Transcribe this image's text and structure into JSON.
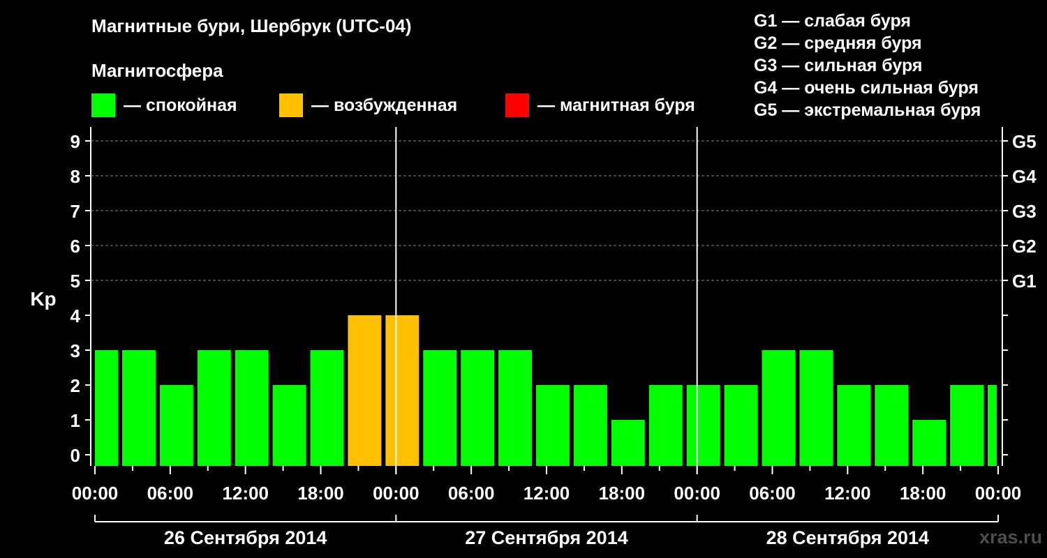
{
  "title": "Магнитные бури, Шербрук (UTC-04)",
  "magnetosphere_heading": "Магнитосфера",
  "legend": [
    {
      "color": "#00ff00",
      "label": "— спокойная"
    },
    {
      "color": "#ffc000",
      "label": "— возбужденная"
    },
    {
      "color": "#ff0000",
      "label": "— магнитная буря"
    }
  ],
  "g_levels": [
    "G1 — слабая буря",
    "G2 — средняя буря",
    "G3 — сильная буря",
    "G4 — очень сильная буря",
    "G5 — экстремальная буря"
  ],
  "watermark": "xras.ru",
  "colors": {
    "quiet": "#00ff00",
    "active": "#ffc000",
    "storm": "#ff0000",
    "background": "#000000",
    "foreground": "#ffffff"
  },
  "chart_data": {
    "type": "bar",
    "ylabel": "Kp",
    "ylim": [
      0,
      9
    ],
    "yticks": [
      0,
      1,
      2,
      3,
      4,
      5,
      6,
      7,
      8,
      9
    ],
    "right_axis_labels": [
      {
        "kp": 5,
        "label": "G1"
      },
      {
        "kp": 6,
        "label": "G2"
      },
      {
        "kp": 7,
        "label": "G3"
      },
      {
        "kp": 8,
        "label": "G4"
      },
      {
        "kp": 9,
        "label": "G5"
      }
    ],
    "x_range_hours": [
      0,
      72
    ],
    "bar_interval_hours": 3,
    "bar_start_hour": -1,
    "values": [
      3,
      3,
      2,
      3,
      3,
      2,
      3,
      4,
      4,
      3,
      3,
      3,
      2,
      2,
      1,
      2,
      2,
      2,
      3,
      3,
      2,
      2,
      1,
      2,
      2
    ],
    "bar_categories": [
      "quiet",
      "quiet",
      "quiet",
      "quiet",
      "quiet",
      "quiet",
      "quiet",
      "active",
      "active",
      "quiet",
      "quiet",
      "quiet",
      "quiet",
      "quiet",
      "quiet",
      "quiet",
      "quiet",
      "quiet",
      "quiet",
      "quiet",
      "quiet",
      "quiet",
      "quiet",
      "quiet",
      "quiet"
    ],
    "x_tick_labels": [
      "00:00",
      "06:00",
      "12:00",
      "18:00",
      "00:00",
      "06:00",
      "12:00",
      "18:00",
      "00:00",
      "06:00",
      "12:00",
      "18:00",
      "00:00"
    ],
    "day_separators_hours": [
      24,
      48
    ],
    "days": [
      "26 Сентября 2014",
      "27 Сентября 2014",
      "28 Сентября 2014"
    ],
    "grid": "dashed horizontal lines at Kp 5–9"
  }
}
